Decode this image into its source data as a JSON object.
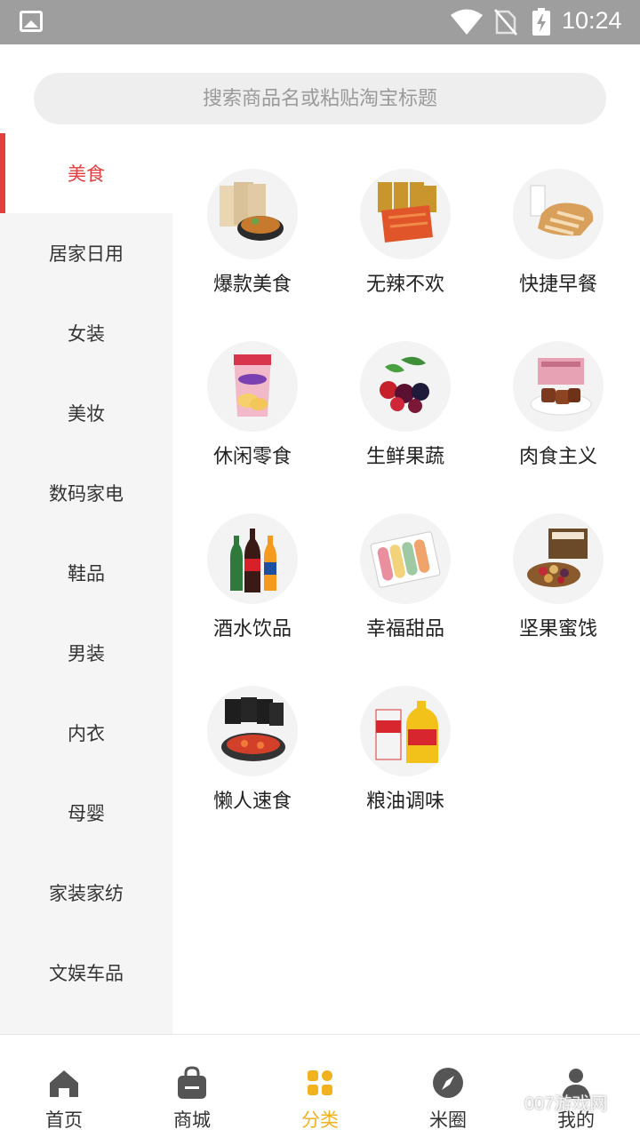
{
  "status_bar": {
    "time": "10:24"
  },
  "search": {
    "placeholder": "搜索商品名或粘贴淘宝标题"
  },
  "sidebar": {
    "items": [
      {
        "label": "美食",
        "active": true
      },
      {
        "label": "居家日用"
      },
      {
        "label": "女装"
      },
      {
        "label": "美妆"
      },
      {
        "label": "数码家电"
      },
      {
        "label": "鞋品"
      },
      {
        "label": "男装"
      },
      {
        "label": "内衣"
      },
      {
        "label": "母婴"
      },
      {
        "label": "家装家纺"
      },
      {
        "label": "文娱车品"
      }
    ]
  },
  "categories": [
    {
      "label": "爆款美食",
      "icon": "instant-noodles-icon"
    },
    {
      "label": "无辣不欢",
      "icon": "spicy-strips-icon"
    },
    {
      "label": "快捷早餐",
      "icon": "bread-milk-icon"
    },
    {
      "label": "休闲零食",
      "icon": "potato-chips-icon"
    },
    {
      "label": "生鲜果蔬",
      "icon": "berries-icon"
    },
    {
      "label": "肉食主义",
      "icon": "braised-meat-icon"
    },
    {
      "label": "酒水饮品",
      "icon": "soda-bottles-icon"
    },
    {
      "label": "幸福甜品",
      "icon": "macarons-icon"
    },
    {
      "label": "坚果蜜饯",
      "icon": "nuts-gift-box-icon"
    },
    {
      "label": "懒人速食",
      "icon": "crayfish-packs-icon"
    },
    {
      "label": "粮油调味",
      "icon": "rice-oil-icon"
    }
  ],
  "bottom_nav": [
    {
      "label": "首页",
      "icon": "home-icon"
    },
    {
      "label": "商城",
      "icon": "shopping-bag-icon"
    },
    {
      "label": "分类",
      "icon": "category-grid-icon",
      "active": true
    },
    {
      "label": "米圈",
      "icon": "compass-icon"
    },
    {
      "label": "我的",
      "icon": "user-icon"
    }
  ],
  "watermark": "007游戏网",
  "colors": {
    "accent_red": "#e33e3e",
    "active_tab": "#f2b21f",
    "status_bar": "#9e9e9e"
  }
}
